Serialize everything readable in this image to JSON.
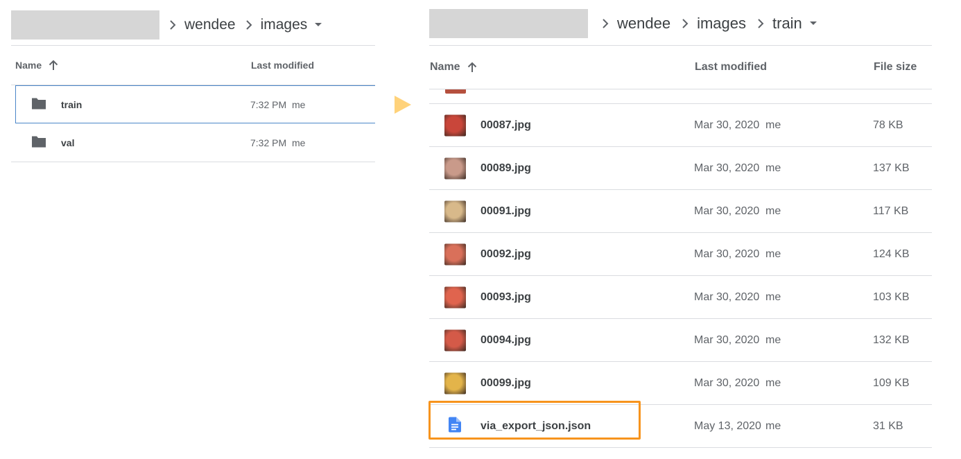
{
  "colors": {
    "folder": "#5f6368",
    "doc_icon": "#4285f4",
    "highlight": "#f7941d",
    "arrow": "#ffd27a",
    "selected_border": "#4a86c8"
  },
  "left": {
    "breadcrumb": [
      {
        "label": "wendee"
      },
      {
        "label": "images"
      }
    ],
    "columns": {
      "name": "Name",
      "modified": "Last modified"
    },
    "rows": [
      {
        "icon": "folder-icon",
        "name": "train",
        "date": "7:32 PM",
        "owner": "me",
        "selected": true
      },
      {
        "icon": "folder-icon",
        "name": "val",
        "date": "7:32 PM",
        "owner": "me",
        "selected": false
      }
    ]
  },
  "right": {
    "breadcrumb": [
      {
        "label": "wendee"
      },
      {
        "label": "images"
      },
      {
        "label": "train"
      }
    ],
    "columns": {
      "name": "Name",
      "modified": "Last modified",
      "size": "File size"
    },
    "rows": [
      {
        "name": "00087.jpg",
        "date": "Mar 30, 2020",
        "owner": "me",
        "size": "78 KB",
        "thumb_color": "#c9463a"
      },
      {
        "name": "00089.jpg",
        "date": "Mar 30, 2020",
        "owner": "me",
        "size": "137 KB",
        "thumb_color": "#c99a8a"
      },
      {
        "name": "00091.jpg",
        "date": "Mar 30, 2020",
        "owner": "me",
        "size": "117 KB",
        "thumb_color": "#d8b98a"
      },
      {
        "name": "00092.jpg",
        "date": "Mar 30, 2020",
        "owner": "me",
        "size": "124 KB",
        "thumb_color": "#d9705a"
      },
      {
        "name": "00093.jpg",
        "date": "Mar 30, 2020",
        "owner": "me",
        "size": "103 KB",
        "thumb_color": "#e0644e"
      },
      {
        "name": "00094.jpg",
        "date": "Mar 30, 2020",
        "owner": "me",
        "size": "132 KB",
        "thumb_color": "#d45a48"
      },
      {
        "name": "00099.jpg",
        "date": "Mar 30, 2020",
        "owner": "me",
        "size": "109 KB",
        "thumb_color": "#e3b44a"
      },
      {
        "name": "via_export_json.json",
        "date": "May 13, 2020",
        "owner": "me",
        "size": "31 KB",
        "icon": "google-doc-icon",
        "highlighted": true
      }
    ]
  }
}
